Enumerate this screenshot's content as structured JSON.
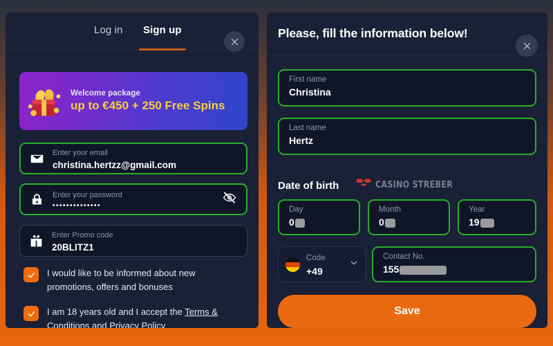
{
  "colors": {
    "page_background_top": "#2b2f3d",
    "page_background_bottom": "#e8650d",
    "panel": "#1a2036",
    "input_background": "#101628",
    "valid_border": "#26b02a",
    "accent_orange": "#ea6a11",
    "banner_purple": "#8d24c9",
    "banner_blue": "#2f46c9",
    "banner_gold": "#f5cf3f"
  },
  "left_panel": {
    "tabs": [
      {
        "label": "Log in",
        "active": false,
        "name": "tab-login"
      },
      {
        "label": "Sign up",
        "active": true,
        "name": "tab-signup"
      }
    ],
    "close_icon": "close-icon",
    "banner": {
      "icon": "gift-treasure-icon",
      "eyebrow": "Welcome package",
      "headline": "up to €450 + 250 Free Spins"
    },
    "fields": [
      {
        "name": "email-field",
        "icon": "envelope-icon",
        "label": "Enter your email",
        "value": "christina.hertzz@gmail.com",
        "valid": true
      },
      {
        "name": "password-field",
        "icon": "lock-icon",
        "label": "Enter your password",
        "value": "••••••••••••••",
        "valid": true,
        "trailing_icon": "eye-off-icon"
      },
      {
        "name": "promo-code-field",
        "icon": "gift-icon",
        "label": "Enter Promo code",
        "value": "20BLITZ1",
        "valid": false
      }
    ],
    "checkboxes": [
      {
        "name": "checkbox-promotions",
        "checked": true,
        "text": "I would like to be informed about new promotions, offers and bonuses"
      },
      {
        "name": "checkbox-age-terms",
        "checked": true,
        "text_before": "I am 18 years old and I accept the ",
        "link_1": "Terms & Conditions",
        "text_between": " and ",
        "link_2": "Privacy Policy"
      }
    ]
  },
  "right_panel": {
    "title": "Please, fill the information below!",
    "close_icon": "close-icon",
    "first_name": {
      "label": "First name",
      "value": "Christina"
    },
    "last_name": {
      "label": "Last name",
      "value": "Hertz"
    },
    "dob_section_label": "Date of birth",
    "watermark": {
      "icon": "glasses-mustache-icon",
      "text": "CASINO STREBER",
      "color": "#8b90a4",
      "icon_color": "#e8382f"
    },
    "day": {
      "label": "Day",
      "value": "0",
      "redacted": true
    },
    "month": {
      "label": "Month",
      "value": "0",
      "redacted": true
    },
    "year": {
      "label": "Year",
      "value": "19",
      "redacted": true
    },
    "code": {
      "label": "Code",
      "value": "+49",
      "flag": "germany-flag-icon",
      "chevron": "chevron-down-icon"
    },
    "contact": {
      "label": "Contact No.",
      "value": "155",
      "redacted": true
    },
    "save_label": "Save"
  }
}
